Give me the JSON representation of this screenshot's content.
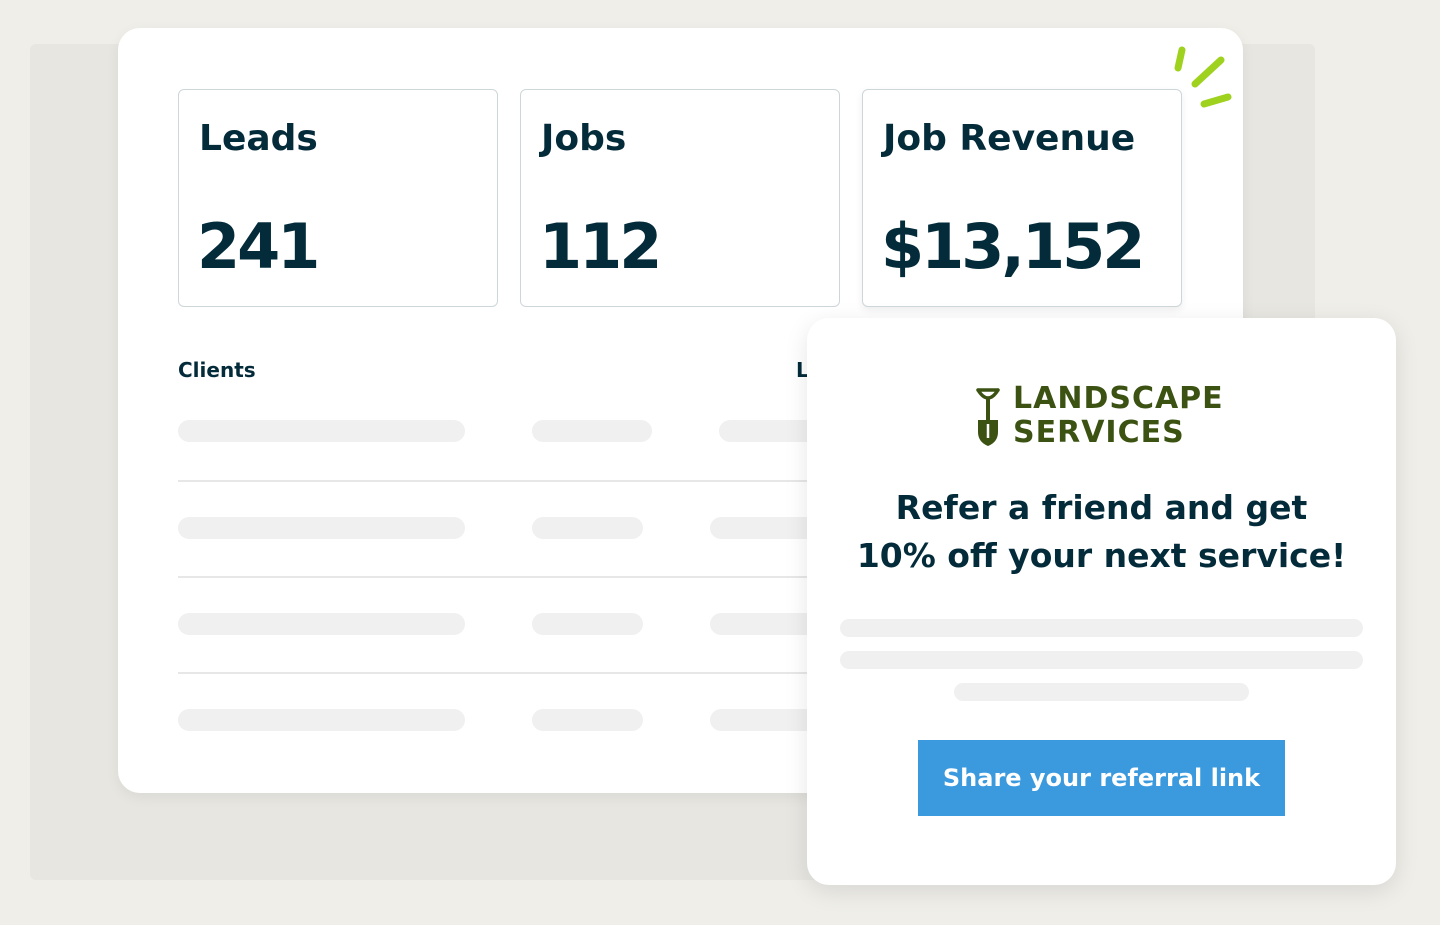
{
  "stats": {
    "leads": {
      "label": "Leads",
      "value": "241"
    },
    "jobs": {
      "label": "Jobs",
      "value": "112"
    },
    "revenue": {
      "label": "Job Revenue",
      "value": "$13,152"
    }
  },
  "table": {
    "clients_header": "Clients",
    "second_header_partial": "L"
  },
  "promo": {
    "brand_line1": "LANDSCAPE",
    "brand_line2": "SERVICES",
    "headline_line1": "Refer a friend and get",
    "headline_line2": "10% off your next service!",
    "button_label": "Share your referral link"
  },
  "colors": {
    "text_dark": "#032b3a",
    "brand_green": "#3b5213",
    "button_blue": "#3b9ade",
    "sparkle_green": "#9fd21f"
  }
}
